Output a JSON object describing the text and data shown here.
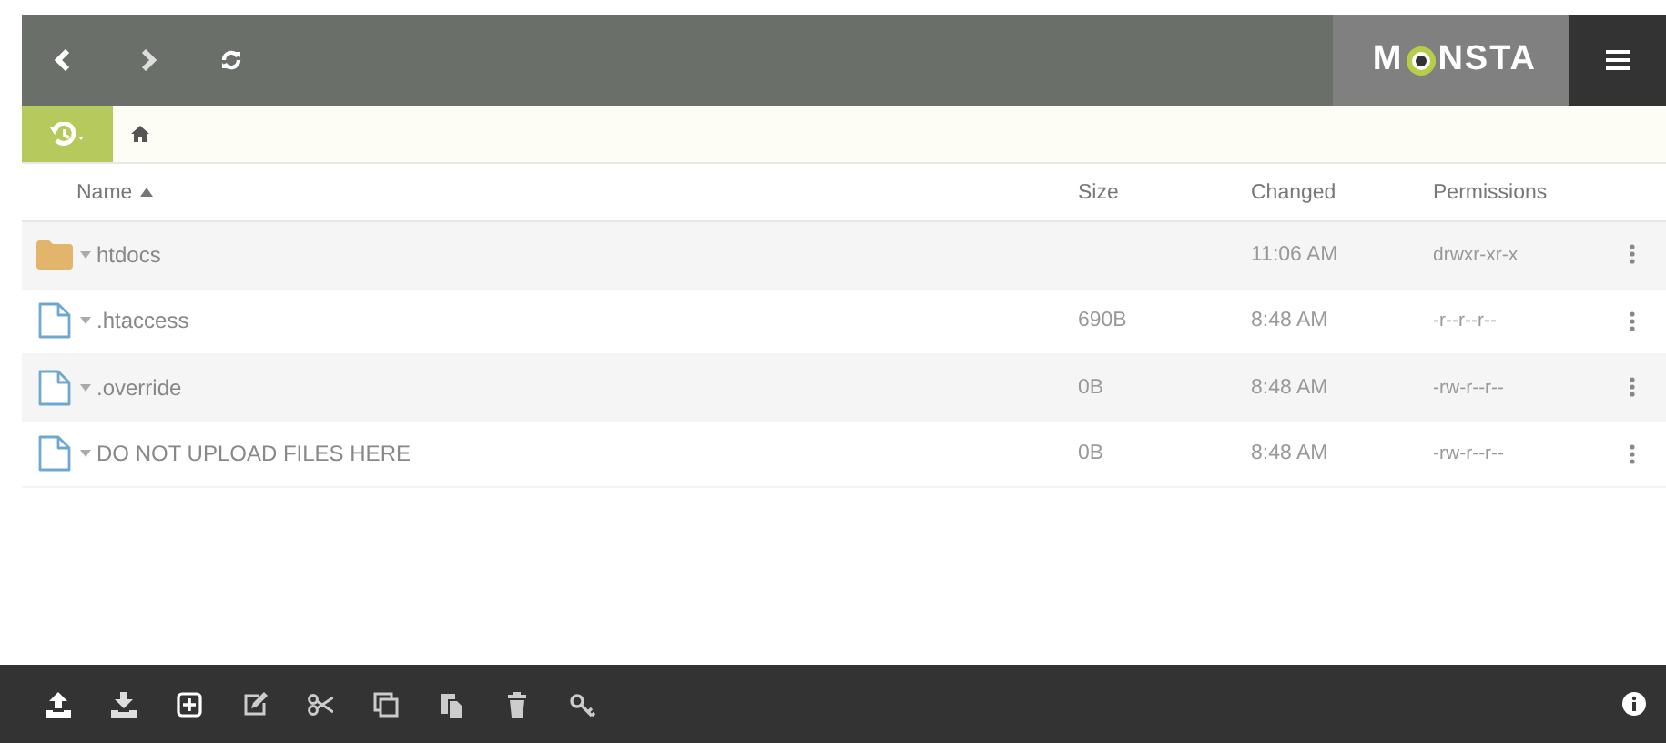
{
  "logo": {
    "before_eye": "M",
    "after_eye": "NSTA"
  },
  "table": {
    "columns": [
      {
        "label": "Name",
        "sorted": true
      },
      {
        "label": "Size",
        "sorted": false
      },
      {
        "label": "Changed",
        "sorted": false
      },
      {
        "label": "Permissions",
        "sorted": false
      }
    ],
    "rows": [
      {
        "kind": "folder",
        "name": "htdocs",
        "size": "",
        "changed": "11:06 AM",
        "permissions": "drwxr-xr-x"
      },
      {
        "kind": "file",
        "name": ".htaccess",
        "size": "690B",
        "changed": "8:48 AM",
        "permissions": "-r--r--r--"
      },
      {
        "kind": "file",
        "name": ".override",
        "size": "0B",
        "changed": "8:48 AM",
        "permissions": "-rw-r--r--"
      },
      {
        "kind": "file",
        "name": "DO NOT UPLOAD FILES HERE",
        "size": "0B",
        "changed": "8:48 AM",
        "permissions": "-rw-r--r--"
      }
    ]
  },
  "toolbar": {
    "buttons": [
      {
        "kind": "upload"
      },
      {
        "kind": "download"
      },
      {
        "kind": "new"
      },
      {
        "kind": "edit"
      },
      {
        "kind": "cut"
      },
      {
        "kind": "copy"
      },
      {
        "kind": "paste"
      },
      {
        "kind": "delete"
      },
      {
        "kind": "key"
      }
    ],
    "info": {
      "kind": "info"
    }
  }
}
